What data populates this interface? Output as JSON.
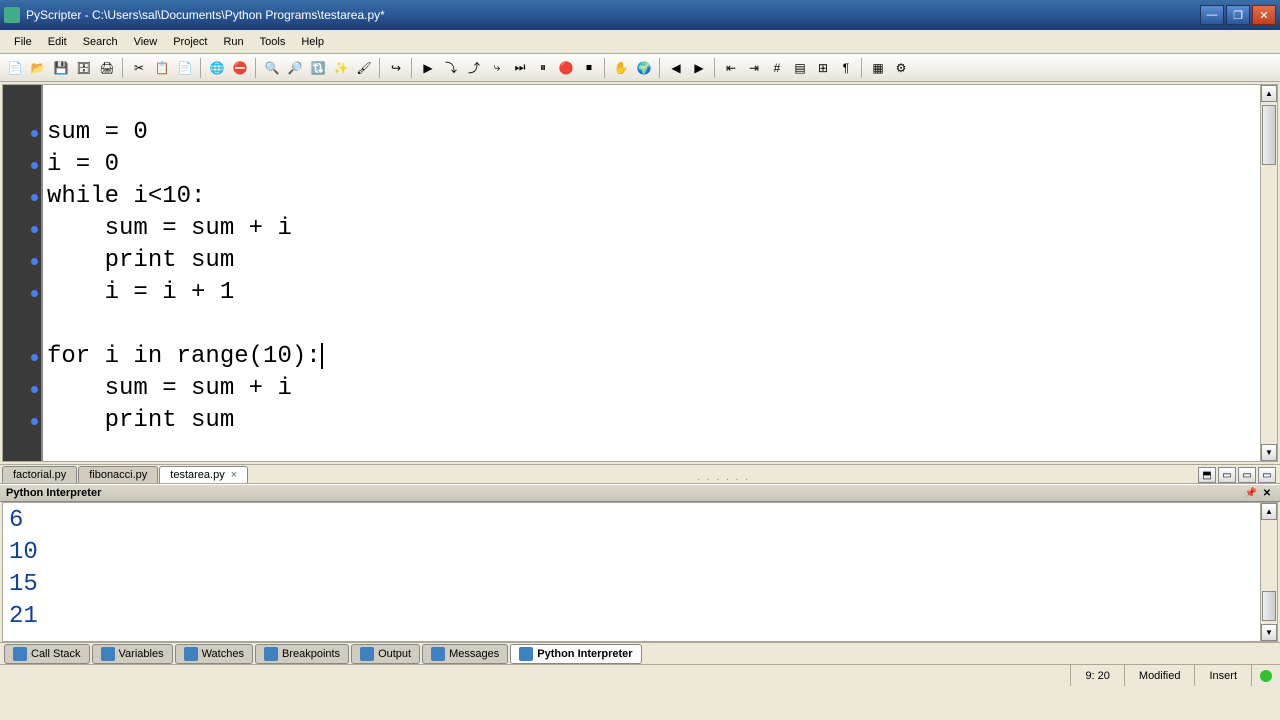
{
  "window": {
    "title": "PyScripter - C:\\Users\\sal\\Documents\\Python Programs\\testarea.py*"
  },
  "menu": {
    "items": [
      "File",
      "Edit",
      "Search",
      "View",
      "Project",
      "Run",
      "Tools",
      "Help"
    ]
  },
  "toolbar_icons": [
    "new-file",
    "open-file",
    "save",
    "save-all",
    "print",
    "cut",
    "copy",
    "paste",
    "run-browser",
    "stop-browser",
    "find",
    "find-next",
    "replace",
    "highlight",
    "brush",
    "goto",
    "play",
    "step-into",
    "step-over",
    "step-out",
    "run-to",
    "pause",
    "breakpoint",
    "stop2",
    "hand",
    "globe",
    "back",
    "forward",
    "outdent",
    "indent",
    "hash",
    "list",
    "format",
    "paragraph",
    "grid",
    "prefs"
  ],
  "code_lines": [
    "",
    "sum = 0",
    "i = 0",
    "while i<10:",
    "    sum = sum + i",
    "    print sum",
    "    i = i + 1",
    "",
    "for i in range(10):",
    "    sum = sum + i",
    "    print sum"
  ],
  "cursor_line": 8,
  "tabs": {
    "items": [
      "factorial.py",
      "fibonacci.py",
      "testarea.py"
    ],
    "active": 2
  },
  "interpreter": {
    "title": "Python Interpreter",
    "output": [
      "6",
      "10",
      "15",
      "21"
    ]
  },
  "bottom_tabs": {
    "items": [
      "Call Stack",
      "Variables",
      "Watches",
      "Breakpoints",
      "Output",
      "Messages",
      "Python Interpreter"
    ],
    "active": 6
  },
  "status": {
    "pos": "9: 20",
    "state": "Modified",
    "mode": "Insert"
  }
}
